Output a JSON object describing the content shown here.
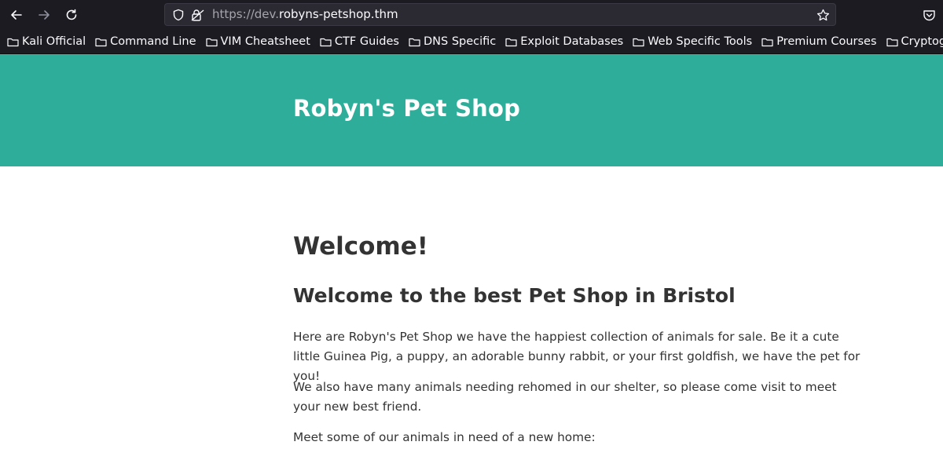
{
  "browser": {
    "url_prefix": "https://dev.",
    "url_domain": "robyns-petshop.thm",
    "bookmarks": [
      {
        "label": "Kali Official"
      },
      {
        "label": "Command Line"
      },
      {
        "label": "VIM Cheatsheet"
      },
      {
        "label": "CTF Guides"
      },
      {
        "label": "DNS Specific"
      },
      {
        "label": "Exploit Databases"
      },
      {
        "label": "Web Specific Tools"
      },
      {
        "label": "Premium Courses"
      },
      {
        "label": "Cryptography"
      }
    ]
  },
  "header": {
    "title": "Robyn's Pet Shop"
  },
  "main": {
    "heading": "Welcome!",
    "subheading": "Welcome to the best Pet Shop in Bristol",
    "paragraphs": [
      "Here are Robyn's Pet Shop we have the happiest collection of animals for sale. Be it a cute little Guinea Pig, a puppy, an adorable bunny rabbit, or your first goldfish, we have the pet for you!",
      "We also have many animals needing rehomed in our shelter, so please come visit to meet your new best friend.",
      "Meet some of our animals in need of a new home:"
    ]
  },
  "colors": {
    "hero": "#2eae9a",
    "chrome": "#1c1b22",
    "text": "#333333"
  }
}
